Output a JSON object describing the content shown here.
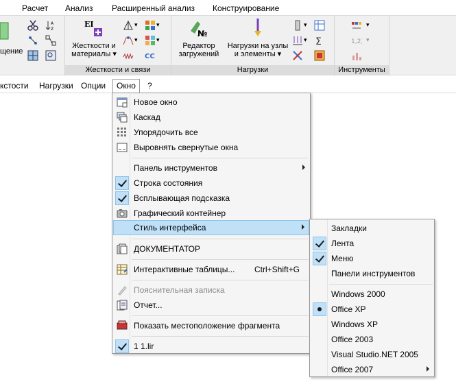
{
  "ribbon_tabs": [
    "Расчет",
    "Анализ",
    "Расширенный анализ",
    "Конструирование"
  ],
  "ribbon": {
    "group1_button": "щение",
    "group2_button_line1": "Жесткости и",
    "group2_button_line2": "материалы",
    "group2_label": "Жесткости и связи",
    "group3_button1_line1": "Редактор",
    "group3_button1_line2": "загружений",
    "group3_button2_line1": "Нагрузки на узлы",
    "group3_button2_line2": "и элементы",
    "group3_label": "Нагрузки",
    "group4_label": "Инструменты"
  },
  "menubar": [
    "кстости",
    "Нагрузки",
    "Опции",
    "Окно",
    "?"
  ],
  "window_menu": [
    {
      "label": "Новое окно",
      "icon": "new-window-icon"
    },
    {
      "label": "Каскад",
      "icon": "cascade-icon"
    },
    {
      "label": "Упорядочить все",
      "icon": "tile-icon"
    },
    {
      "label": "Выровнять свернутые окна",
      "icon": "arrange-minimized-icon"
    },
    {
      "label": "Панель инструментов",
      "submenu": true
    },
    {
      "label": "Строка состояния",
      "checked": true
    },
    {
      "label": "Всплывающая подсказка",
      "checked": true
    },
    {
      "label": "Графический контейнер",
      "icon": "camera-icon"
    },
    {
      "label": "Стиль интерфейса",
      "submenu": true,
      "highlighted": true
    },
    {
      "label": "ДОКУМЕНТАТОР",
      "icon": "documents-icon"
    },
    {
      "label": "Интерактивные таблицы...",
      "shortcut": "Ctrl+Shift+G",
      "icon": "table-icon"
    },
    {
      "label": "Пояснительная записка",
      "disabled": true,
      "icon": "note-icon"
    },
    {
      "label": "Отчет...",
      "icon": "report-icon"
    },
    {
      "label": "Показать местоположение фрагмента",
      "icon": "fragment-icon"
    },
    {
      "label": "1 1.lir",
      "checked": true
    }
  ],
  "style_submenu": [
    {
      "label": "Закладки"
    },
    {
      "label": "Лента",
      "checked": true
    },
    {
      "label": "Меню",
      "checked": true
    },
    {
      "label": "Панели инструментов"
    },
    {
      "label": "Windows 2000"
    },
    {
      "label": "Office XP",
      "selected": true
    },
    {
      "label": "Windows XP"
    },
    {
      "label": "Office 2003"
    },
    {
      "label": "Visual Studio.NET 2005"
    },
    {
      "label": "Office 2007",
      "submenu": true
    }
  ]
}
